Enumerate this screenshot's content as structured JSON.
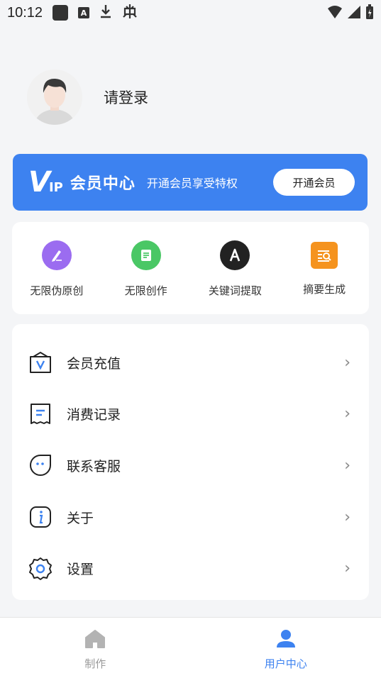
{
  "status_bar": {
    "time": "10:12",
    "icons_left": [
      "app-square-icon",
      "a-box-icon",
      "download-icon",
      "bug-icon"
    ],
    "icons_right": [
      "wifi-icon",
      "signal-icon",
      "battery-icon"
    ]
  },
  "profile": {
    "login_text": "请登录"
  },
  "vip": {
    "logo_v": "V",
    "logo_ip": "IP",
    "title": "会员中心",
    "subtitle": "开通会员享受特权",
    "button_label": "开通会员",
    "color": "#3d82f0"
  },
  "features": [
    {
      "label": "无限伪原创",
      "icon": "pen-icon",
      "color": "#9b6cf0"
    },
    {
      "label": "无限创作",
      "icon": "document-icon",
      "color": "#4ac765"
    },
    {
      "label": "关键词提取",
      "icon": "letter-a-icon",
      "color": "#222222"
    },
    {
      "label": "摘要生成",
      "icon": "search-document-icon",
      "color": "#f5931e"
    }
  ],
  "menu": [
    {
      "label": "会员充值",
      "icon": "vip-bag-icon"
    },
    {
      "label": "消费记录",
      "icon": "receipt-icon"
    },
    {
      "label": "联系客服",
      "icon": "chat-icon"
    },
    {
      "label": "关于",
      "icon": "info-icon"
    },
    {
      "label": "设置",
      "icon": "gear-icon"
    }
  ],
  "bottom_nav": [
    {
      "label": "制作",
      "icon": "home-icon",
      "active": false
    },
    {
      "label": "用户中心",
      "icon": "user-icon",
      "active": true
    }
  ],
  "colors": {
    "accent": "#3d82f0",
    "background": "#f4f5f7"
  }
}
